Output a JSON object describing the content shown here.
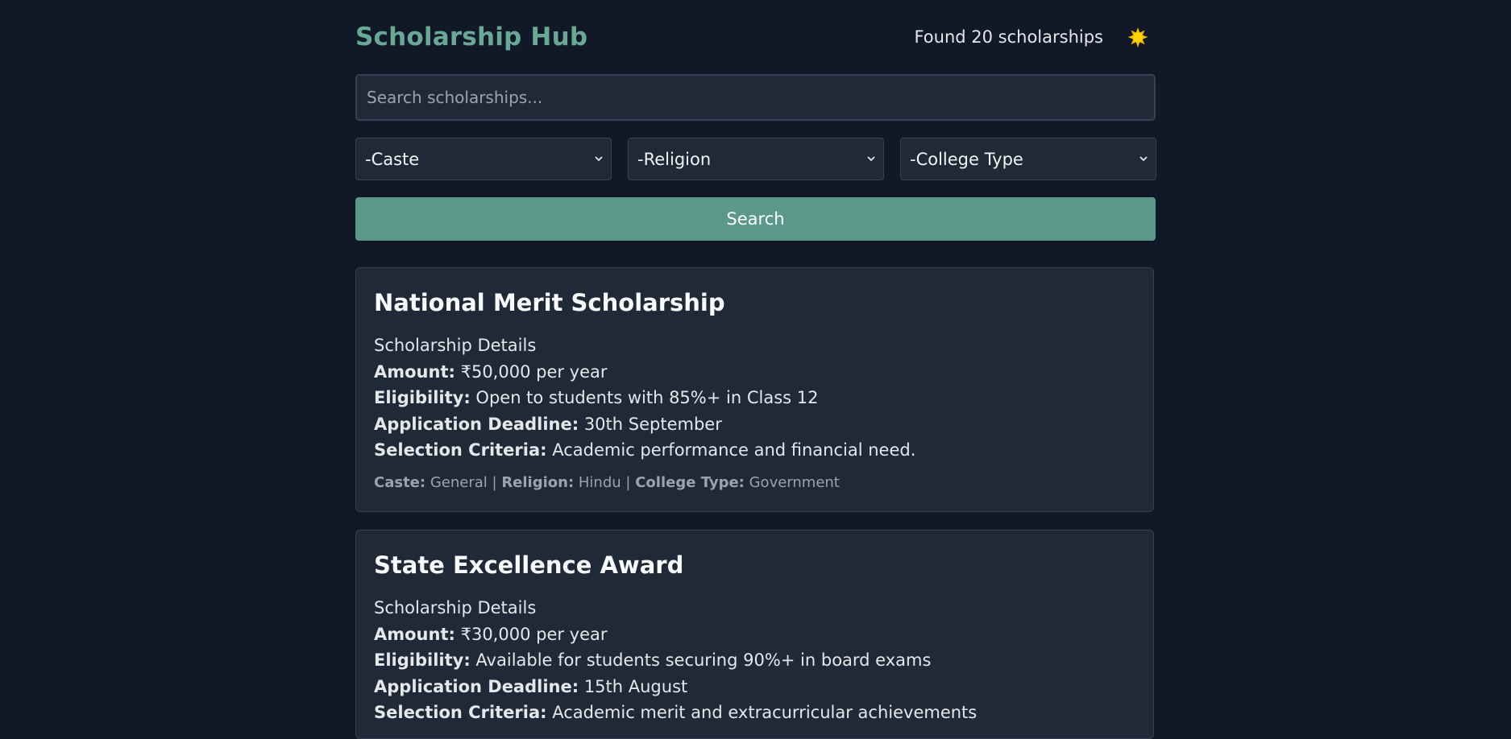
{
  "header": {
    "title": "Scholarship Hub",
    "found_text": "Found 20 scholarships",
    "theme_icon": "sun-icon"
  },
  "search": {
    "placeholder": "Search scholarships...",
    "button_label": "Search"
  },
  "filters": {
    "caste": "-Caste",
    "religion": "-Religion",
    "college_type": "-College Type"
  },
  "labels": {
    "details_heading": "Scholarship Details",
    "amount": "Amount:",
    "eligibility": "Eligibility:",
    "deadline": "Application Deadline:",
    "criteria": "Selection Criteria:",
    "caste": "Caste:",
    "religion": "Religion:",
    "college_type": "College Type:",
    "separator": "|"
  },
  "scholarships": [
    {
      "name": "National Merit Scholarship",
      "amount": "₹50,000 per year",
      "eligibility": "Open to students with 85%+ in Class 12",
      "deadline": "30th September",
      "criteria": "Academic performance and financial need.",
      "caste": "General",
      "religion": "Hindu",
      "college_type": "Government"
    },
    {
      "name": "State Excellence Award",
      "amount": "₹30,000 per year",
      "eligibility": "Available for students securing 90%+ in board exams",
      "deadline": "15th August",
      "criteria": "Academic merit and extracurricular achievements"
    }
  ],
  "colors": {
    "background": "#111827",
    "accent": "#5a9987",
    "title": "#68a895",
    "card": "#1f2937"
  }
}
